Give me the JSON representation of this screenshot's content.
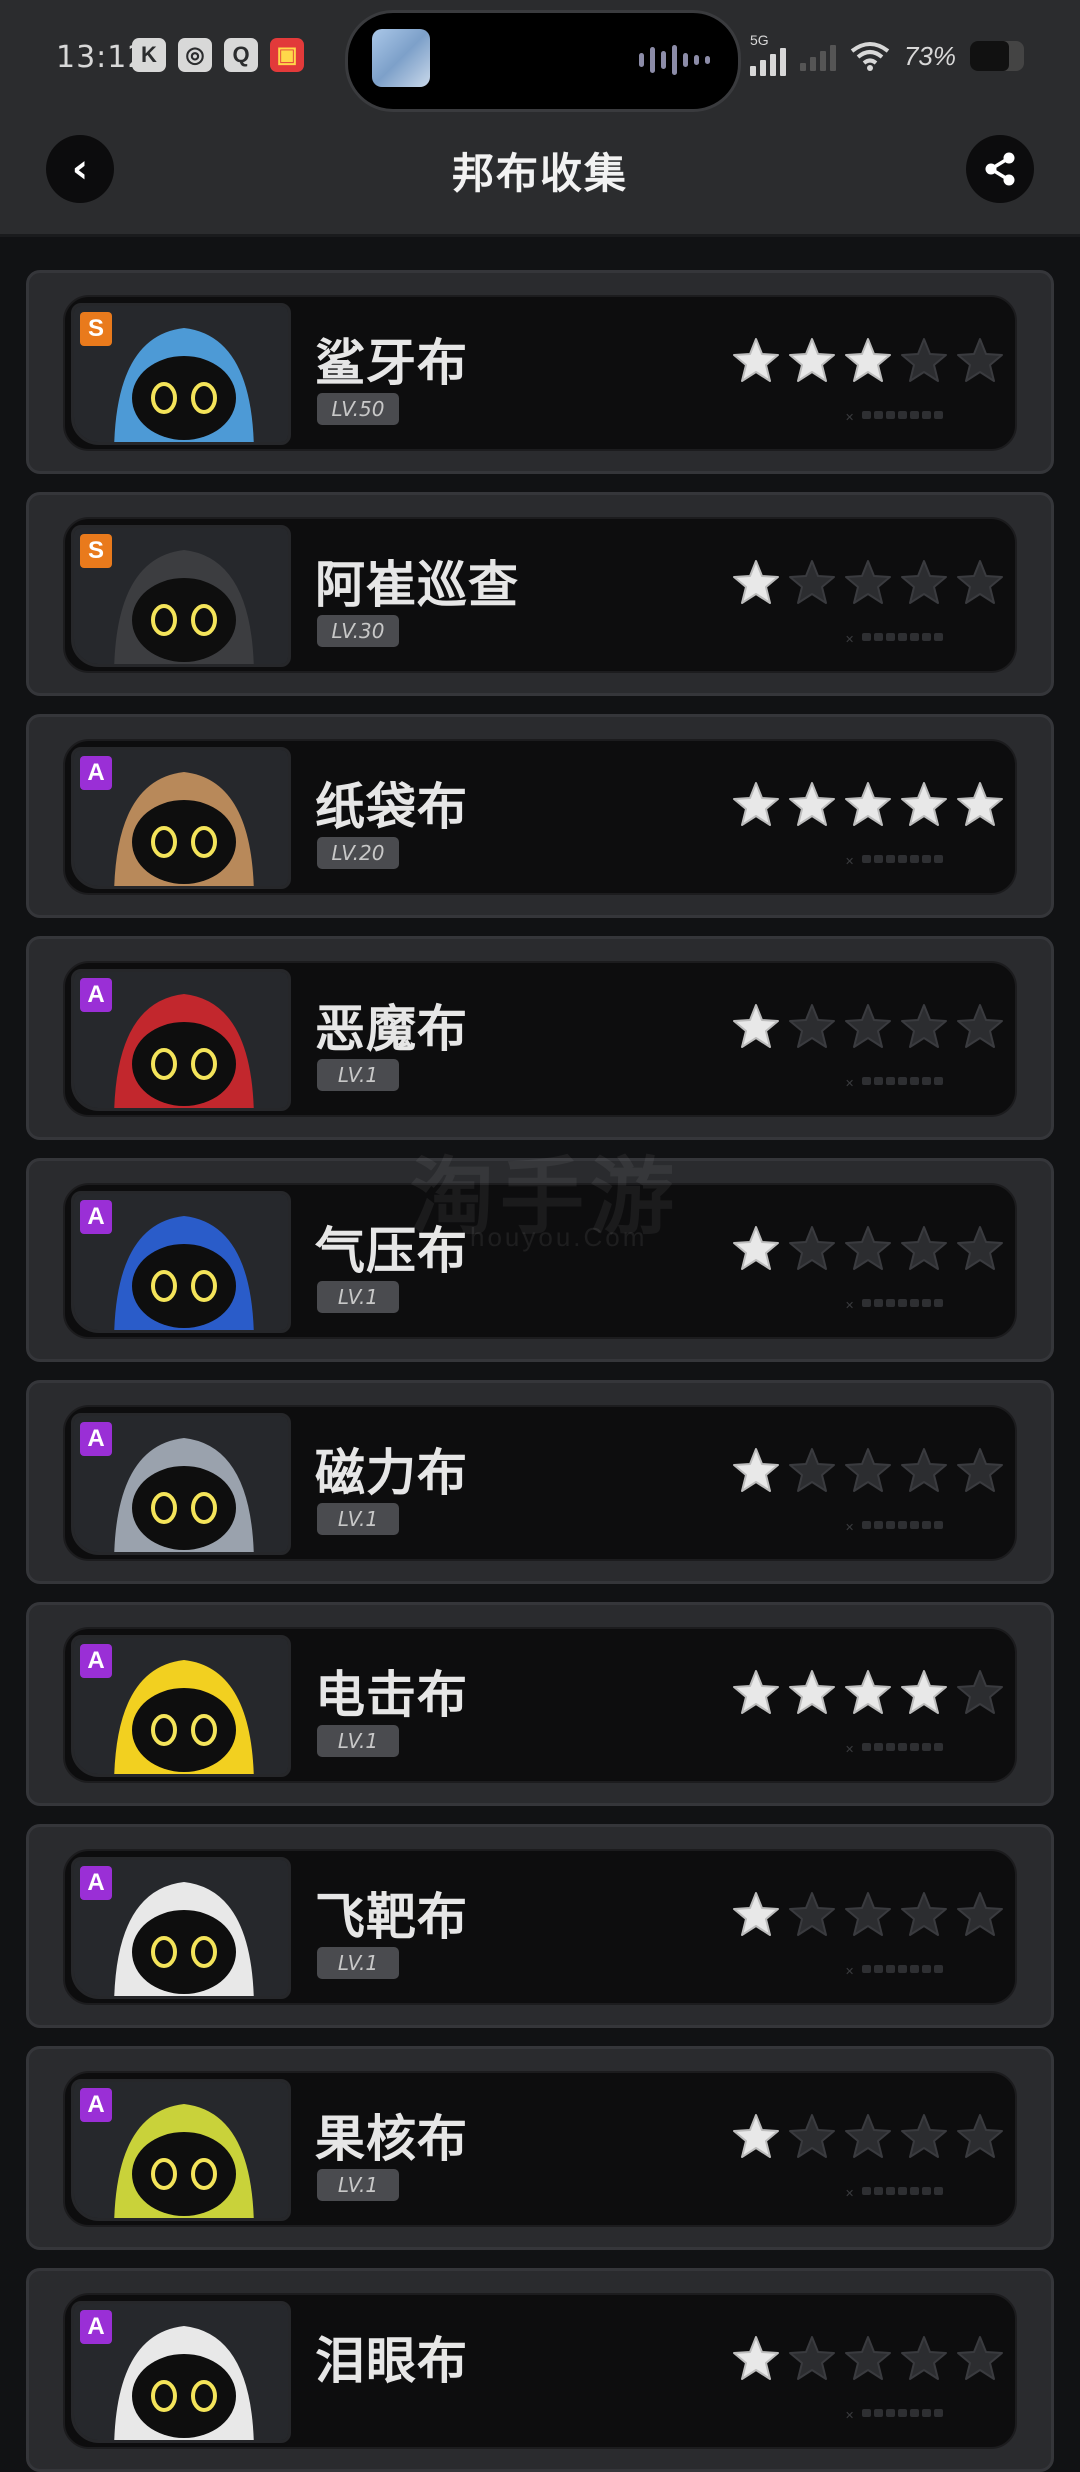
{
  "status_bar": {
    "time": "13:12",
    "battery_text": "73%",
    "battery_level": 0.73,
    "network": "5G"
  },
  "header": {
    "title": "邦布收集",
    "back_icon": "chevron-left-icon",
    "share_icon": "share-icon"
  },
  "watermark": {
    "text": "淘手游",
    "sub": "houyou.Com"
  },
  "bangboo_list": [
    {
      "name": "鲨牙布",
      "rank": "S",
      "level": "LV.50",
      "stars": 3,
      "colors": {
        "body": "#4d9ad6",
        "face": "#111"
      }
    },
    {
      "name": "阿崔巡查",
      "rank": "S",
      "level": "LV.30",
      "stars": 1,
      "colors": {
        "body": "#3c3d40",
        "face": "#111"
      }
    },
    {
      "name": "纸袋布",
      "rank": "A",
      "level": "LV.20",
      "stars": 5,
      "colors": {
        "body": "#b8895a",
        "face": "#111"
      }
    },
    {
      "name": "恶魔布",
      "rank": "A",
      "level": "LV.1",
      "stars": 1,
      "colors": {
        "body": "#c2272d",
        "face": "#111"
      }
    },
    {
      "name": "气压布",
      "rank": "A",
      "level": "LV.1",
      "stars": 1,
      "colors": {
        "body": "#2a5cc9",
        "face": "#111"
      }
    },
    {
      "name": "磁力布",
      "rank": "A",
      "level": "LV.1",
      "stars": 1,
      "colors": {
        "body": "#9aa2ad",
        "face": "#111"
      }
    },
    {
      "name": "电击布",
      "rank": "A",
      "level": "LV.1",
      "stars": 4,
      "colors": {
        "body": "#f2d020",
        "face": "#111"
      }
    },
    {
      "name": "飞靶布",
      "rank": "A",
      "level": "LV.1",
      "stars": 1,
      "colors": {
        "body": "#e8e8e8",
        "face": "#d22"
      }
    },
    {
      "name": "果核布",
      "rank": "A",
      "level": "LV.1",
      "stars": 1,
      "colors": {
        "body": "#c9d23a",
        "face": "#111"
      }
    },
    {
      "name": "泪眼布",
      "rank": "A",
      "level": "",
      "stars": 1,
      "colors": {
        "body": "#e8e8e8",
        "face": "#111"
      }
    }
  ],
  "colors": {
    "star_on": "#e8e8e8",
    "star_off": "#2c2d30",
    "rank_S": "#e97a1c",
    "rank_A": "#9a2fd6"
  }
}
